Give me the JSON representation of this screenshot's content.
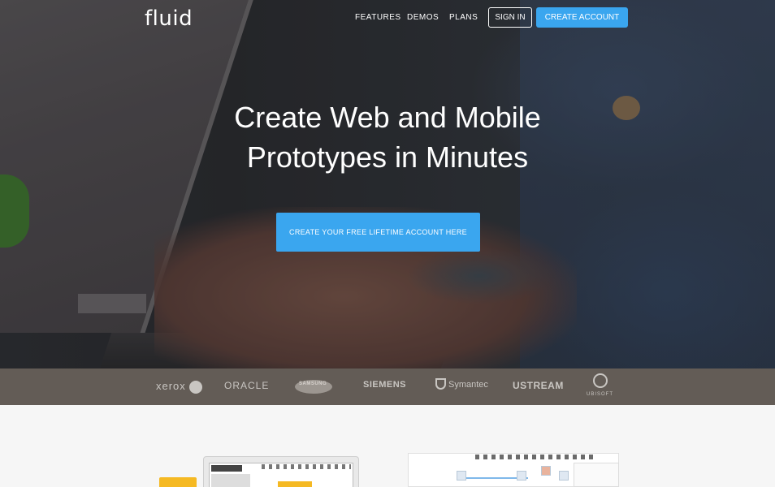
{
  "nav": {
    "logo": "fluid",
    "links": [
      "FEATURES",
      "DEMOS",
      "PLANS"
    ],
    "signin_label": "SIGN IN",
    "create_label": "CREATE ACCOUNT"
  },
  "hero": {
    "headline_line1": "Create Web and Mobile",
    "headline_line2": "Prototypes in Minutes",
    "cta_label": "CREATE YOUR FREE LIFETIME ACCOUNT HERE"
  },
  "clients": [
    "xerox",
    "ORACLE",
    "SAMSUNG",
    "SIEMENS",
    "Symantec",
    "USTREAM",
    "UBISOFT"
  ],
  "colors": {
    "accent": "#3aa6ef",
    "hero_dark": "#2c2f33",
    "logo_strip": "#564e48",
    "below_bg": "#f6f6f6"
  }
}
